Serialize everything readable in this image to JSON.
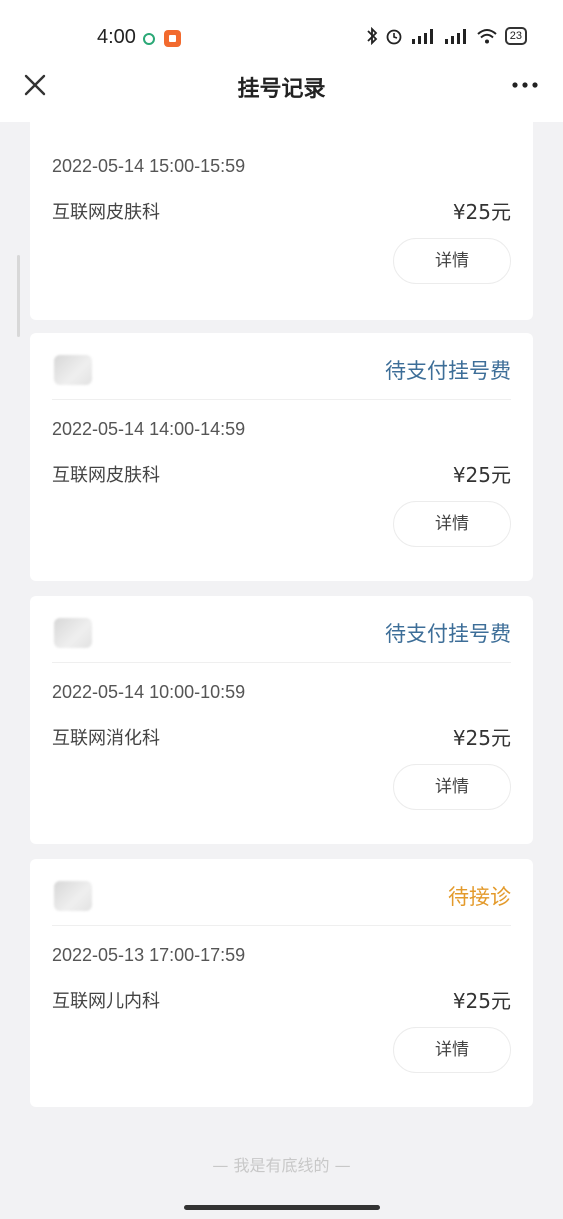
{
  "statusbar": {
    "time": "4:00",
    "battery": "23"
  },
  "nav": {
    "title": "挂号记录"
  },
  "records": [
    {
      "status": "",
      "datetime": "2022-05-14 15:00-15:59",
      "department": "互联网皮肤科",
      "price": "¥25元",
      "detail_label": "详情"
    },
    {
      "status": "待支付挂号费",
      "datetime": "2022-05-14 14:00-14:59",
      "department": "互联网皮肤科",
      "price": "¥25元",
      "detail_label": "详情"
    },
    {
      "status": "待支付挂号费",
      "datetime": "2022-05-14 10:00-10:59",
      "department": "互联网消化科",
      "price": "¥25元",
      "detail_label": "详情"
    },
    {
      "status": "待接诊",
      "datetime": "2022-05-13 17:00-17:59",
      "department": "互联网儿内科",
      "price": "¥25元",
      "detail_label": "详情"
    }
  ],
  "footer": "— 我是有底线的 —",
  "colors": {
    "pending_payment": "#3d6e98",
    "pending_visit": "#e39a2b"
  }
}
